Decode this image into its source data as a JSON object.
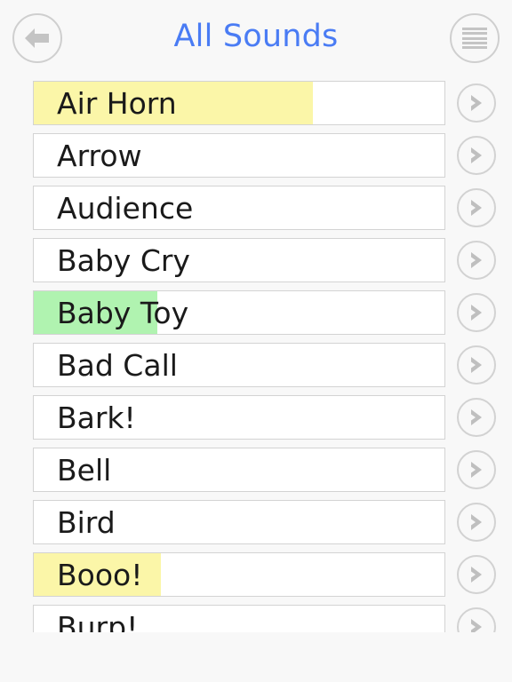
{
  "header": {
    "title": "All Sounds",
    "back_button": {
      "label": "Back",
      "icon": "back-arrow-icon"
    },
    "menu_button": {
      "label": "Menu",
      "icon": "hamburger-menu-icon"
    },
    "title_color": "#4a7cf4"
  },
  "colors": {
    "background": "#f8f8f8",
    "cell_background": "#ffffff",
    "cell_border": "#d3d3d3",
    "text": "#1a1a1a",
    "accent_blue": "#4a7cf4",
    "icon_gray": "#c4c4c4",
    "highlight_yellow": "#fbf6a8",
    "highlight_green": "#b0f3b0"
  },
  "list": {
    "row_accessory_icon": "chevron-right-icon",
    "rows": [
      {
        "label": "Air Horn",
        "highlight_color": "#fbf6a8",
        "highlight_percent": 68
      },
      {
        "label": "Arrow",
        "highlight_color": "",
        "highlight_percent": 0
      },
      {
        "label": "Audience",
        "highlight_color": "",
        "highlight_percent": 0
      },
      {
        "label": "Baby Cry",
        "highlight_color": "",
        "highlight_percent": 0
      },
      {
        "label": "Baby Toy",
        "highlight_color": "#b0f3b0",
        "highlight_percent": 30
      },
      {
        "label": "Bad Call",
        "highlight_color": "",
        "highlight_percent": 0
      },
      {
        "label": "Bark!",
        "highlight_color": "",
        "highlight_percent": 0
      },
      {
        "label": "Bell",
        "highlight_color": "",
        "highlight_percent": 0
      },
      {
        "label": "Bird",
        "highlight_color": "",
        "highlight_percent": 0
      },
      {
        "label": "Booo!",
        "highlight_color": "#fbf6a8",
        "highlight_percent": 31
      },
      {
        "label": "Burp!",
        "highlight_color": "",
        "highlight_percent": 0
      }
    ]
  }
}
